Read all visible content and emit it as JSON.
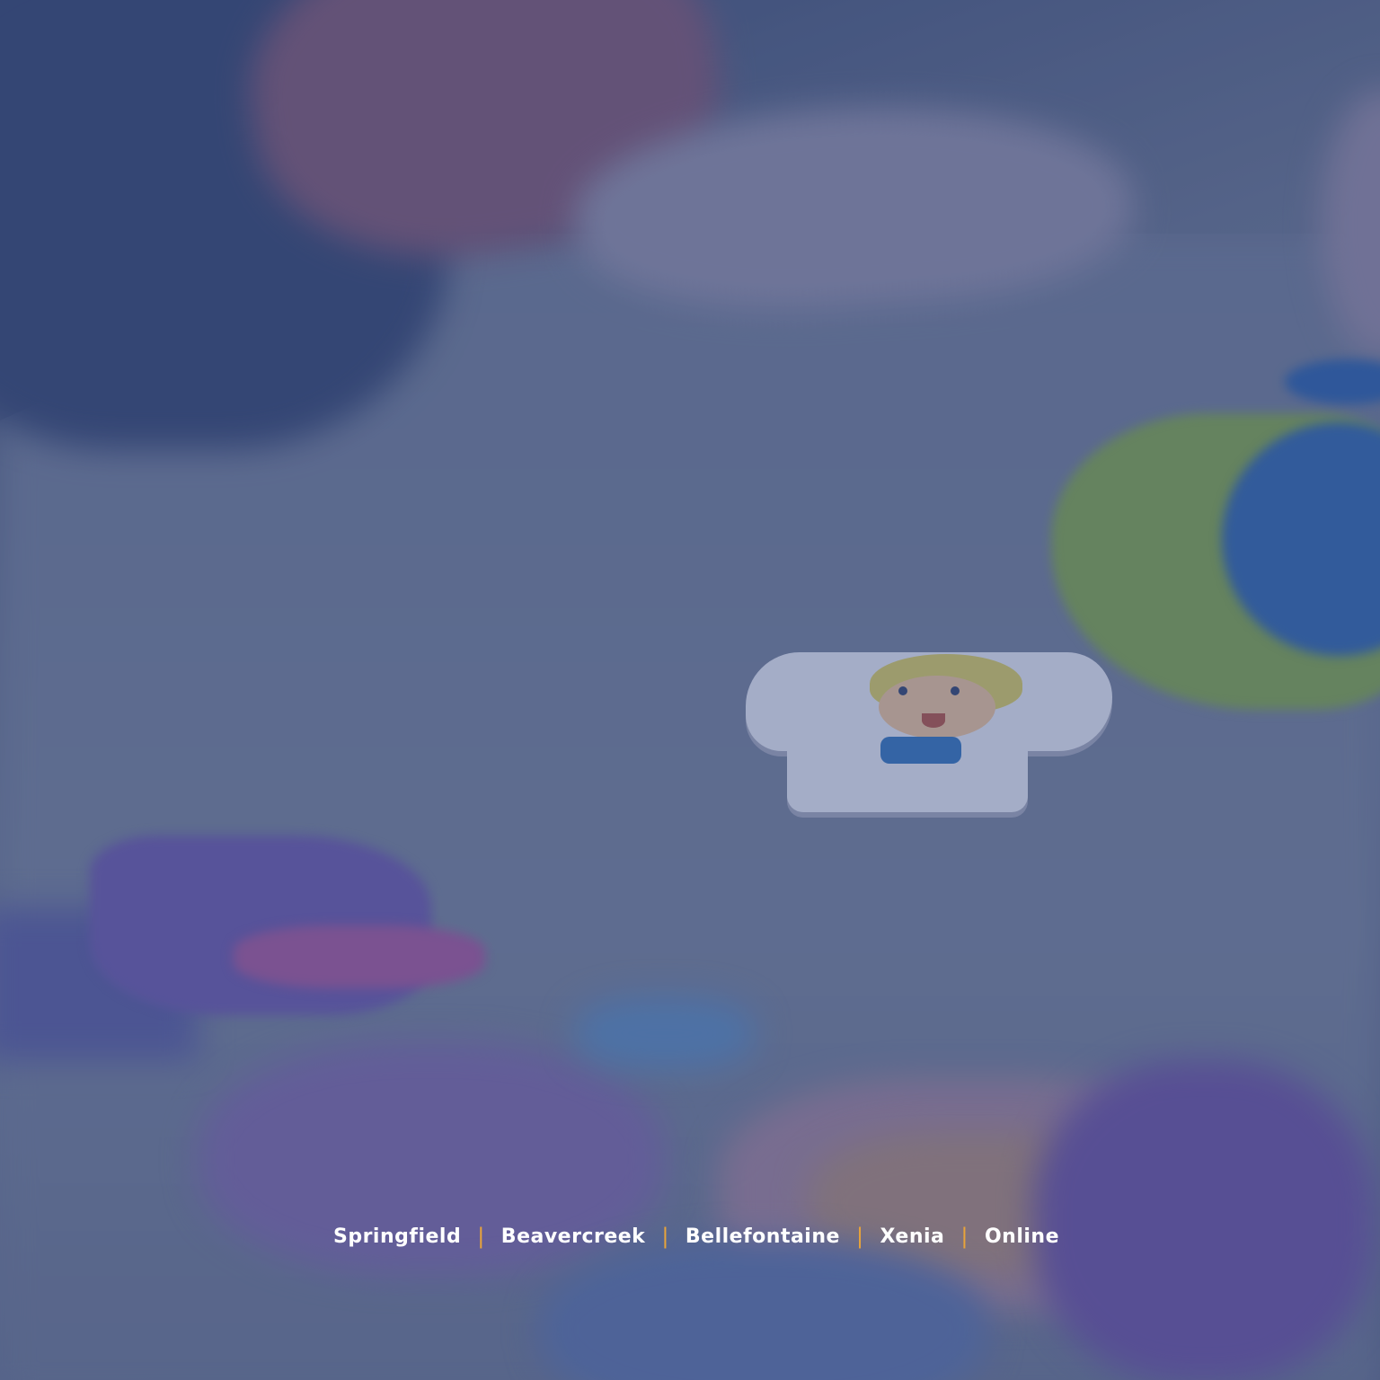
{
  "image": {
    "description_kind": "blurred photo background with bluish overlay",
    "overlay_color": "#283c78",
    "accent_color": "#e8a43a"
  },
  "locations": {
    "separator": "|",
    "items": [
      {
        "label": "Springfield"
      },
      {
        "label": "Beavercreek"
      },
      {
        "label": "Bellefontaine"
      },
      {
        "label": "Xenia"
      },
      {
        "label": "Online"
      }
    ]
  }
}
